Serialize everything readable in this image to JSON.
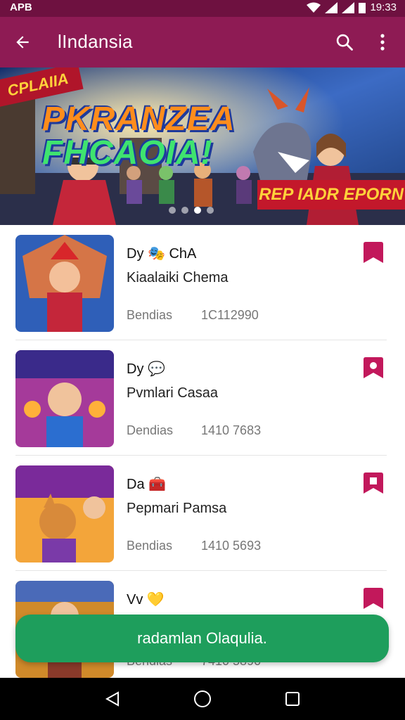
{
  "status_bar": {
    "carrier": "APB",
    "time": "19:33"
  },
  "app_bar": {
    "title": "lIndansia"
  },
  "banner": {
    "tag": "CPLAIIA",
    "headline_line1": "PKRANZEA",
    "headline_line2": "FHCAOIA!",
    "ribbon": "REP IADR EPORN",
    "page_count": 4,
    "active_page": 3
  },
  "items": [
    {
      "name": "Dy 🎭 ChA",
      "subtitle": "Kiaalaiki Chema",
      "meta_label": "Bendias",
      "meta_value": "1C112990"
    },
    {
      "name": "Dy 💬",
      "subtitle": "Pvmlari Casaa",
      "meta_label": "Dendias",
      "meta_value": "1410 7683"
    },
    {
      "name": "Da 🧰",
      "subtitle": "Pepmari Pamsa",
      "meta_label": "Bendias",
      "meta_value": "1410 5693"
    },
    {
      "name": "Vv 💛",
      "subtitle": "",
      "meta_label": "Bendias",
      "meta_value": "7410 5890"
    }
  ],
  "snackbar": {
    "message": "radamlan Olaqulia."
  },
  "colors": {
    "primary": "#8e1b54",
    "status": "#6e1140",
    "accent": "#c2185b",
    "snackbar": "#1e9e5c"
  }
}
